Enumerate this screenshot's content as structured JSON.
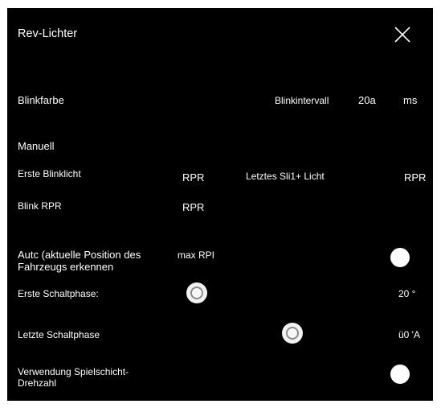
{
  "dialog": {
    "title": "Rev-Lichter",
    "close_icon": "close-icon"
  },
  "blink": {
    "color_label": "Blinkfarbe",
    "interval_label": "Blinkintervall",
    "interval_value": "20a",
    "interval_unit": "ms"
  },
  "manual": {
    "section_label": "Manuell",
    "first_light_label": "Erste Blinklicht",
    "first_light_value": "RPR",
    "last_light_label": "Letztes Sli1+ Licht",
    "last_light_value": "RPR",
    "blink_rpr_label": "Blink RPR",
    "blink_rpr_value": "RPR"
  },
  "auto": {
    "label": "Autc (aktuelle Position des Fahrzeugs erkennen",
    "max_label": "max RPI",
    "toggle_on": true,
    "first_shift_label": "Erste Schaltphase:",
    "first_shift_value": "20 °",
    "last_shift_label": "Letzte Schaltphase",
    "last_shift_value": "ü0 'A",
    "game_rpm_label": "Verwendung Spielschicht-Drehzahl",
    "game_rpm_toggle_on": true
  }
}
